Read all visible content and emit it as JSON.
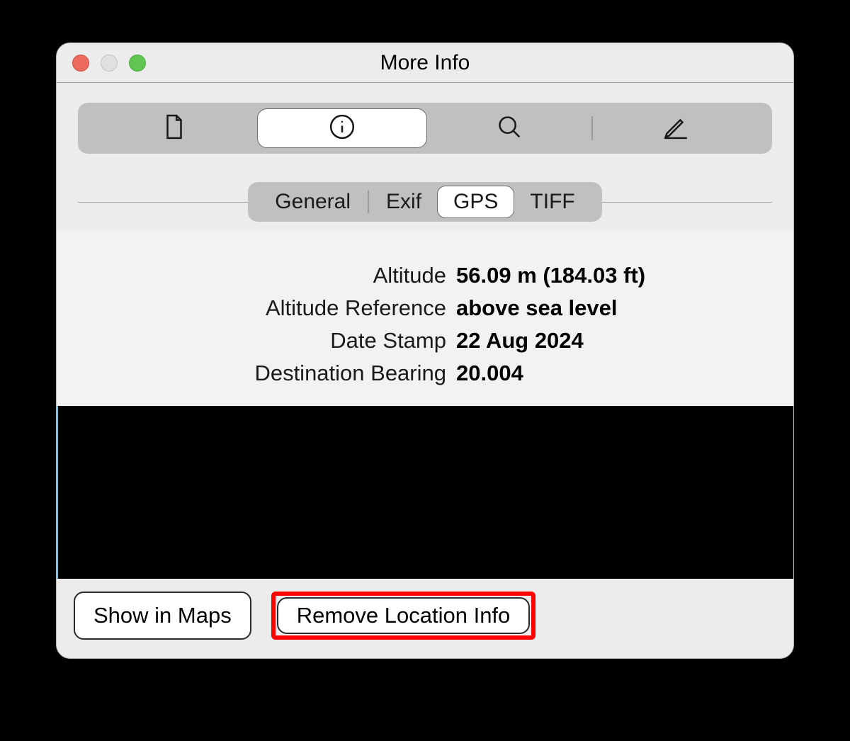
{
  "window": {
    "title": "More Info"
  },
  "toolbar": {
    "items": [
      "document",
      "info",
      "search",
      "edit"
    ],
    "selected": "info"
  },
  "tabs": {
    "items": [
      "General",
      "Exif",
      "GPS",
      "TIFF"
    ],
    "selected": "GPS"
  },
  "gps": {
    "rows": [
      {
        "label": "Altitude",
        "value": "56.09 m (184.03 ft)"
      },
      {
        "label": "Altitude Reference",
        "value": "above sea level"
      },
      {
        "label": "Date Stamp",
        "value": "22 Aug 2024"
      },
      {
        "label": "Destination Bearing",
        "value": "20.004"
      }
    ]
  },
  "buttons": {
    "show_in_maps": "Show in Maps",
    "remove_location": "Remove Location Info"
  }
}
